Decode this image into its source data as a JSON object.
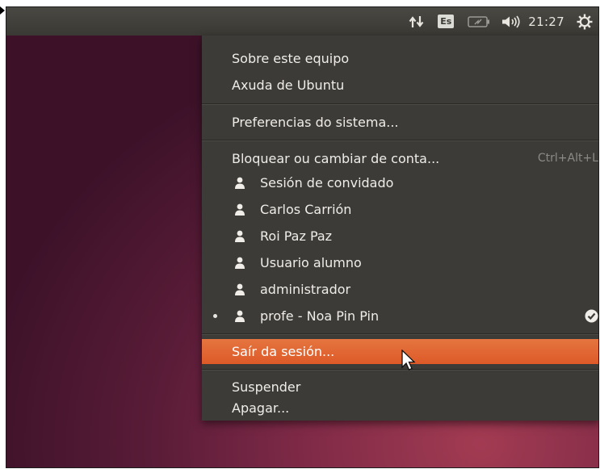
{
  "topbar": {
    "input_language": "Es",
    "clock": "21:27",
    "icons": [
      "network-icon",
      "battery-icon",
      "volume-icon",
      "gear-icon"
    ]
  },
  "menu": {
    "items": [
      {
        "label": "Sobre este equipo"
      },
      {
        "label": "Axuda de Ubuntu"
      },
      {
        "label": "Preferencias do sistema..."
      },
      {
        "label": "Bloquear ou cambiar de conta...",
        "accelerator": "Ctrl+Alt+L"
      }
    ],
    "users": [
      {
        "label": "Sesión de convidado"
      },
      {
        "label": "Carlos Carrión"
      },
      {
        "label": "Roi Paz Paz"
      },
      {
        "label": "Usuario alumno"
      },
      {
        "label": "administrador"
      },
      {
        "label": "profe - Noa Pin Pin",
        "current": true
      }
    ],
    "logout": {
      "label": "Saír da sesión..."
    },
    "power": [
      {
        "label": "Suspender"
      },
      {
        "label": "Apagar..."
      }
    ]
  },
  "colors": {
    "panel": "#3c3b37",
    "highlight": "#dd5a28",
    "desktop": "#5a1c38"
  }
}
